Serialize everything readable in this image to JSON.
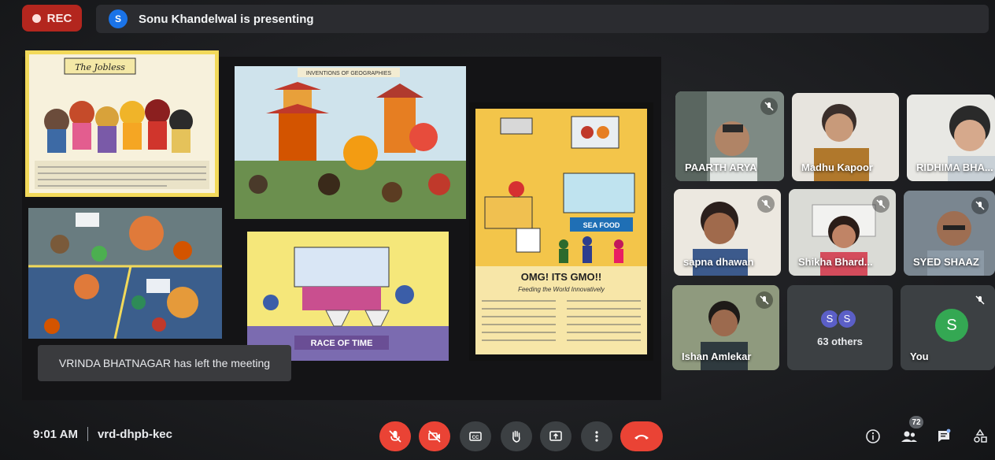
{
  "recording": {
    "label": "REC",
    "color": "#b3261e"
  },
  "presenter": {
    "avatar_letter": "S",
    "text": "Sonu Khandelwal is presenting"
  },
  "presentation": {
    "slide_texts": {
      "banner_1": "The Jobless",
      "banner_2": "INVENTIONS OF GEOGRAPHIES",
      "race": "RACE OF TIME",
      "gmo_title": "OMG! ITS GMO!!",
      "gmo_sub": "Feeding the World Innovatively",
      "seafood": "SEA FOOD"
    }
  },
  "notification": {
    "text": "VRINDA BHATNAGAR has left the meeting"
  },
  "participants": [
    {
      "name": "PAARTH ARYA",
      "muted": true
    },
    {
      "name": "Madhu Kapoor",
      "muted": false
    },
    {
      "name": "RIDHIMA BHA...",
      "muted": false
    },
    {
      "name": "sapna dhawan",
      "muted": true
    },
    {
      "name": "Shikha Bhard...",
      "muted": true
    },
    {
      "name": "SYED SHAAZ",
      "muted": true
    },
    {
      "name": "Ishan Amlekar",
      "muted": true
    }
  ],
  "others_tile": {
    "avatars": [
      "S",
      "S"
    ],
    "label": "63 others"
  },
  "self_tile": {
    "avatar_letter": "S",
    "name": "You"
  },
  "meeting": {
    "time": "9:01 AM",
    "code": "vrd-dhpb-kec"
  },
  "controls": [
    {
      "name": "mic-off-icon",
      "state": "off"
    },
    {
      "name": "camera-off-icon",
      "state": "off"
    },
    {
      "name": "captions-icon",
      "state": "neutral"
    },
    {
      "name": "raise-hand-icon",
      "state": "neutral"
    },
    {
      "name": "present-screen-icon",
      "state": "neutral"
    },
    {
      "name": "more-options-icon",
      "state": "neutral"
    },
    {
      "name": "end-call-icon",
      "state": "end"
    }
  ],
  "right_controls": {
    "people_count": "72"
  },
  "colors": {
    "danger": "#ea4335",
    "control_grey": "#3c4043",
    "tile_bg": "#3c4043"
  }
}
